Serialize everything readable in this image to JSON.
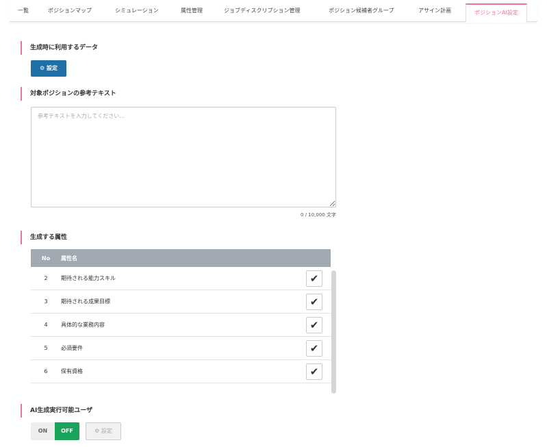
{
  "tabs": [
    "一覧",
    "ポジションマップ",
    "シミュレーション",
    "属性管理",
    "ジョブディスクリプション管理",
    "ポジション候補者グループ",
    "アサイン計画",
    "ポジションAI設定"
  ],
  "active_tab": "ポジションAI設定",
  "section_data": {
    "title": "生成時に利用するデータ",
    "button": "⚙ 設定"
  },
  "section_text": {
    "title": "対象ポジションの参考テキスト",
    "placeholder": "参考テキストを入力してください...",
    "value": "",
    "counter": "0 / 10,000 文字"
  },
  "section_attrs": {
    "title": "生成する属性",
    "headers": {
      "no": "No",
      "name": "属性名"
    },
    "rows": [
      {
        "no": "2",
        "name": "期待される能力スキル",
        "checked": true
      },
      {
        "no": "3",
        "name": "期待される成果目標",
        "checked": true
      },
      {
        "no": "4",
        "name": "具体的な業務内容",
        "checked": true
      },
      {
        "no": "5",
        "name": "必須要件",
        "checked": true
      },
      {
        "no": "6",
        "name": "保有資格",
        "checked": true
      }
    ],
    "check_glyph": "✔"
  },
  "section_users": {
    "title": "AI生成実行可能ユーザ",
    "on": "ON",
    "off": "OFF",
    "selected": "OFF",
    "button": "⚙ 設定"
  },
  "colors": {
    "accent": "#e9739a",
    "primary": "#1f6fa8",
    "toggle_on": "#1aa35a",
    "table_header": "#a1a9b3"
  }
}
